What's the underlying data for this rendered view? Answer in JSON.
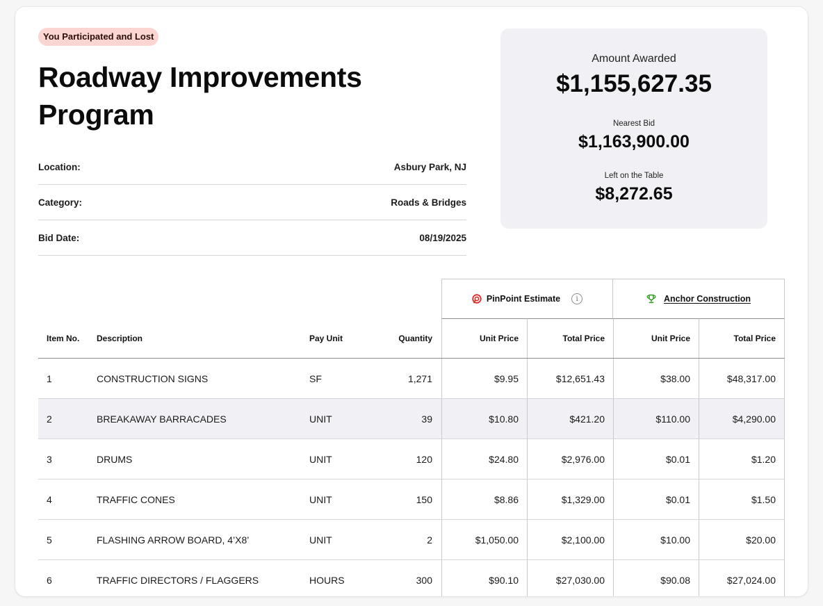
{
  "status_badge": "You Participated and Lost",
  "project": {
    "title": "Roadway Improvements Program"
  },
  "details": [
    {
      "label": "Location:",
      "value": "Asbury Park, NJ"
    },
    {
      "label": "Category:",
      "value": "Roads & Bridges"
    },
    {
      "label": "Bid Date:",
      "value": "08/19/2025"
    }
  ],
  "award": {
    "amount_label": "Amount Awarded",
    "amount_value": "$1,155,627.35",
    "nearest_label": "Nearest Bid",
    "nearest_value": "$1,163,900.00",
    "left_label": "Left on the Table",
    "left_value": "$8,272.65"
  },
  "table": {
    "group_pinpoint": "PinPoint Estimate",
    "group_contractor": "Anchor Construction",
    "columns": {
      "item_no": "Item No.",
      "description": "Description",
      "pay_unit": "Pay Unit",
      "quantity": "Quantity",
      "pp_unit_price": "Unit Price",
      "pp_total_price": "Total Price",
      "ac_unit_price": "Unit Price",
      "ac_total_price": "Total Price"
    },
    "rows": [
      {
        "no": "1",
        "desc": "CONSTRUCTION SIGNS",
        "unit": "SF",
        "qty": "1,271",
        "pp_unit": "$9.95",
        "pp_total": "$12,651.43",
        "ac_unit": "$38.00",
        "ac_total": "$48,317.00"
      },
      {
        "no": "2",
        "desc": "BREAKAWAY BARRACADES",
        "unit": "UNIT",
        "qty": "39",
        "pp_unit": "$10.80",
        "pp_total": "$421.20",
        "ac_unit": "$110.00",
        "ac_total": "$4,290.00"
      },
      {
        "no": "3",
        "desc": "DRUMS",
        "unit": "UNIT",
        "qty": "120",
        "pp_unit": "$24.80",
        "pp_total": "$2,976.00",
        "ac_unit": "$0.01",
        "ac_total": "$1.20"
      },
      {
        "no": "4",
        "desc": "TRAFFIC CONES",
        "unit": "UNIT",
        "qty": "150",
        "pp_unit": "$8.86",
        "pp_total": "$1,329.00",
        "ac_unit": "$0.01",
        "ac_total": "$1.50"
      },
      {
        "no": "5",
        "desc": "FLASHING ARROW BOARD, 4’X8’",
        "unit": "UNIT",
        "qty": "2",
        "pp_unit": "$1,050.00",
        "pp_total": "$2,100.00",
        "ac_unit": "$10.00",
        "ac_total": "$20.00"
      },
      {
        "no": "6",
        "desc": "TRAFFIC DIRECTORS / FLAGGERS",
        "unit": "HOURS",
        "qty": "300",
        "pp_unit": "$90.10",
        "pp_total": "$27,030.00",
        "ac_unit": "$90.08",
        "ac_total": "$27,024.00"
      }
    ]
  },
  "icons": {
    "pinpoint": "pinpoint-logo-icon",
    "info": "info-icon",
    "trophy": "trophy-icon"
  },
  "colors": {
    "badge_bg": "#fbd5d1",
    "pinpoint_red": "#e02a2a",
    "trophy_green": "#2e9b1f",
    "award_bg": "#f1f1f5"
  }
}
